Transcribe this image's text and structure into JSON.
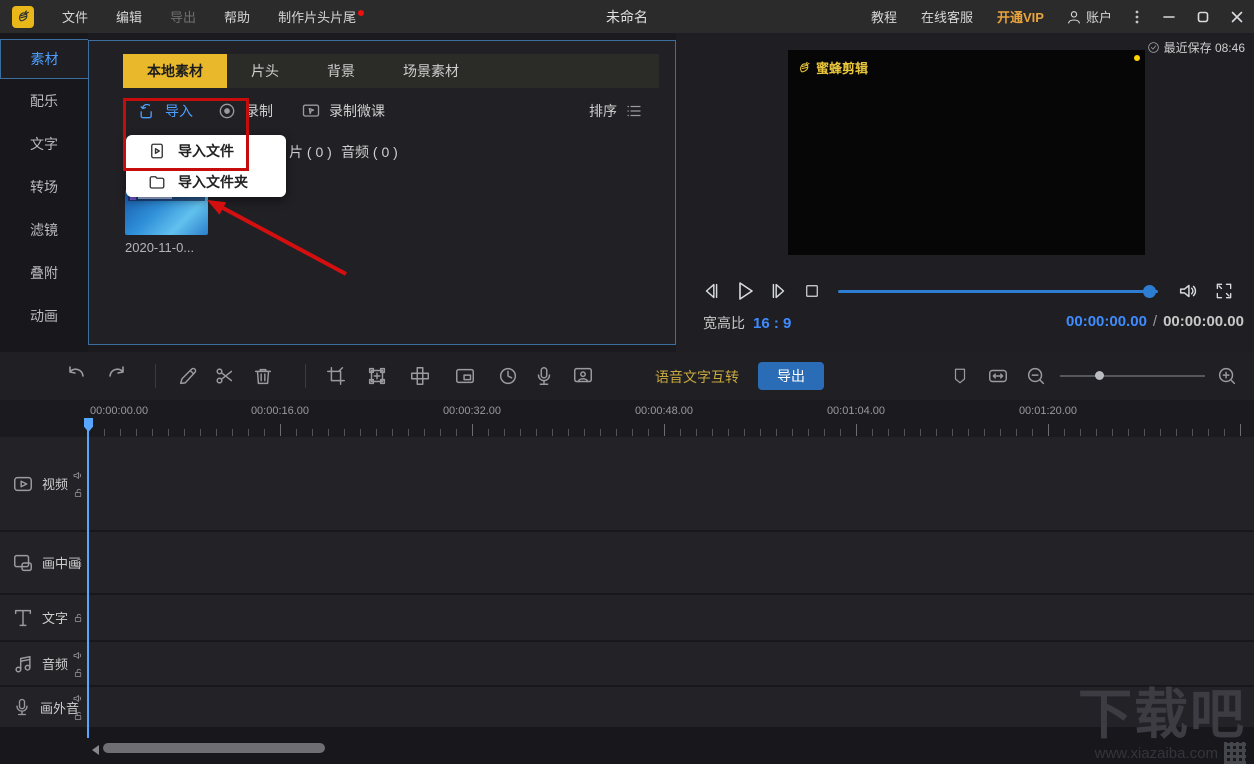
{
  "colors": {
    "accent_blue": "#4da0ff",
    "accent_yellow": "#e9b92b",
    "export_blue": "#2a6cb5",
    "highlight_red": "#c70c0c",
    "vip_orange": "#e8a33d"
  },
  "titlebar": {
    "menus": [
      "文件",
      "编辑",
      "导出",
      "帮助",
      "制作片头片尾"
    ],
    "title": "未命名",
    "tutorial": "教程",
    "support": "在线客服",
    "vip": "开通VIP",
    "account": "账户"
  },
  "sidebar": {
    "items": [
      "素材",
      "配乐",
      "文字",
      "转场",
      "滤镜",
      "叠附",
      "动画"
    ]
  },
  "materials": {
    "tabs": [
      "本地素材",
      "片头",
      "背景",
      "场景素材"
    ],
    "import_label": "导入",
    "record_label": "录制",
    "record_course_label": "录制微课",
    "sort_label": "排序",
    "count_clip": "片 ( 0 )",
    "count_audio": "音频 ( 0 )",
    "menu_import_file": "导入文件",
    "menu_import_folder": "导入文件夹",
    "clip_caption": "2020-11-0..."
  },
  "player": {
    "last_saved": "最近保存 08:46",
    "preview_watermark": "蜜蜂剪辑",
    "aspect_label": "宽高比",
    "aspect_value": "16 : 9",
    "time_current": "00:00:00.00",
    "time_separator": "/",
    "time_total": "00:00:00.00"
  },
  "toolbar": {
    "speech_text_label": "语音文字互转",
    "export_label": "导出"
  },
  "timeline": {
    "ruler_labels": [
      "00:00:00.00",
      "00:00:16.00",
      "00:00:32.00",
      "00:00:48.00",
      "00:01:04.00",
      "00:01:20.00"
    ],
    "tracks": [
      "视频",
      "画中画",
      "文字",
      "音频",
      "画外音"
    ]
  },
  "site_watermark": {
    "title": "下载吧",
    "url": "www.xiazaiba.com"
  }
}
